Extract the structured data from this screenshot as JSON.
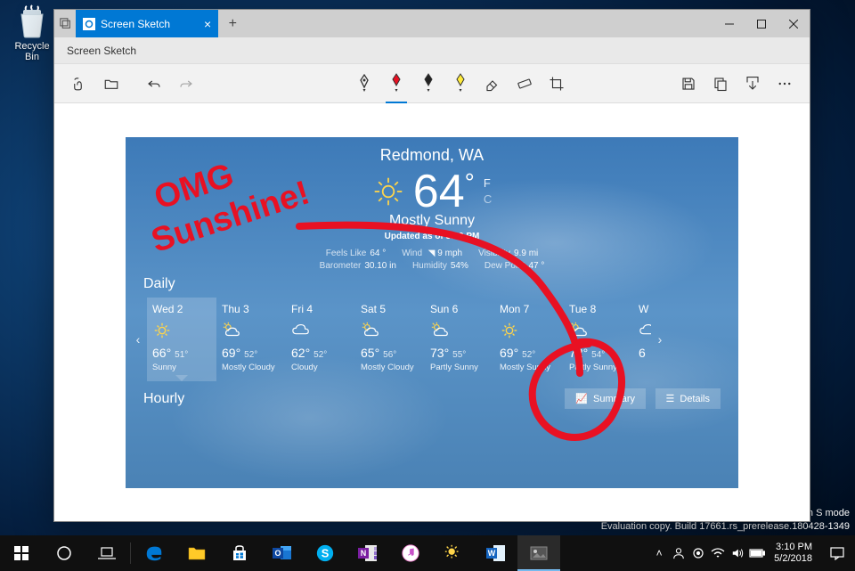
{
  "desktop": {
    "recycle_bin": "Recycle Bin",
    "eval_line1": "in S mode",
    "eval_line2": "Evaluation copy. Build 17661.rs_prerelease.180428-1349"
  },
  "window": {
    "tab_title": "Screen Sketch",
    "subheader": "Screen Sketch"
  },
  "toolbar": {
    "touch": "touch-writing-icon",
    "open": "open-icon",
    "undo": "undo-icon",
    "redo": "redo-icon",
    "save": "save-icon",
    "copy": "copy-icon",
    "share": "share-icon",
    "more": "more-icon",
    "pens": [
      {
        "name": "pen-ball-icon"
      },
      {
        "name": "pen-red-icon"
      },
      {
        "name": "pen-black-icon"
      },
      {
        "name": "highlighter-icon"
      },
      {
        "name": "eraser-icon"
      },
      {
        "name": "ruler-icon"
      },
      {
        "name": "crop-icon"
      }
    ]
  },
  "weather": {
    "location": "Redmond, WA",
    "temp": "64",
    "unit_f": "F",
    "unit_c": "C",
    "condition": "Mostly Sunny",
    "updated": "Updated as of 3:00 PM",
    "feels_label": "Feels Like",
    "feels_val": "64 °",
    "wind_label": "Wind",
    "wind_val": "9 mph",
    "vis_label": "Visibility",
    "vis_val": "9.9 mi",
    "baro_label": "Barometer",
    "baro_val": "30.10 in",
    "hum_label": "Humidity",
    "hum_val": "54%",
    "dew_label": "Dew Point",
    "dew_val": "47 °",
    "daily_title": "Daily",
    "hourly_title": "Hourly",
    "summary_btn": "Summary",
    "details_btn": "Details",
    "days": [
      {
        "name": "Wed 2",
        "hi": "66°",
        "lo": "51°",
        "cond": "Sunny",
        "icon": "sun"
      },
      {
        "name": "Thu 3",
        "hi": "69°",
        "lo": "52°",
        "cond": "Mostly Cloudy",
        "icon": "cloud-sun"
      },
      {
        "name": "Fri 4",
        "hi": "62°",
        "lo": "52°",
        "cond": "Cloudy",
        "icon": "cloud"
      },
      {
        "name": "Sat 5",
        "hi": "65°",
        "lo": "56°",
        "cond": "Mostly Cloudy",
        "icon": "cloud-sun"
      },
      {
        "name": "Sun 6",
        "hi": "73°",
        "lo": "55°",
        "cond": "Partly Sunny",
        "icon": "cloud-sun"
      },
      {
        "name": "Mon 7",
        "hi": "69°",
        "lo": "52°",
        "cond": "Mostly Sunny",
        "icon": "sun"
      },
      {
        "name": "Tue 8",
        "hi": "72°",
        "lo": "54°",
        "cond": "Partly Sunny",
        "icon": "cloud-sun"
      },
      {
        "name": "W",
        "hi": "6",
        "lo": "",
        "cond": "",
        "icon": "cloud"
      }
    ]
  },
  "annotation": {
    "text": "OMG Sunshine!"
  },
  "taskbar": {
    "time": "3:10 PM",
    "date": "5/2/2018"
  }
}
